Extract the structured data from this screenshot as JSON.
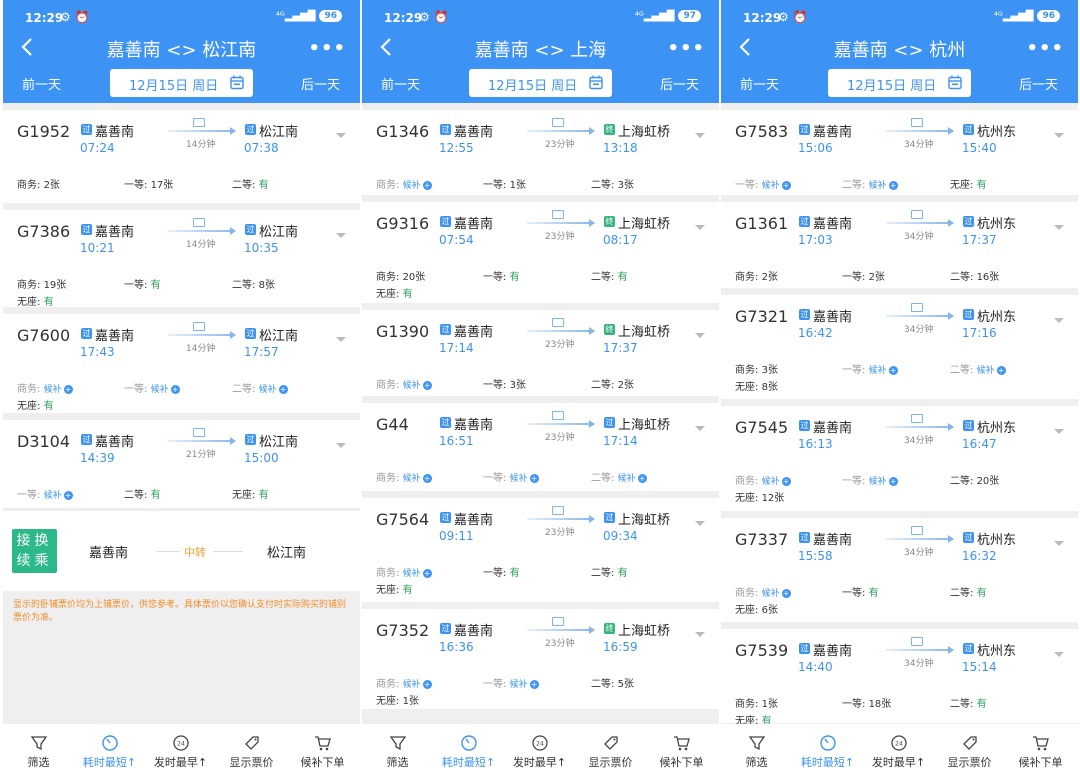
{
  "status": {
    "time": "12:29",
    "icons": "⚙ ⏰",
    "signal": "⁴ᴳ▂▄▆█"
  },
  "labels": {
    "prev_day": "前一天",
    "next_day": "后一天",
    "business": "商务:",
    "first": "一等:",
    "second": "二等:",
    "nostand": "无座:",
    "have": "有",
    "wait": "候补",
    "duration_badge": "过",
    "end_badge": "终"
  },
  "bottom_nav": [
    "筛选",
    "耗时最短↑",
    "发时最早↑",
    "显示票价",
    "候补下单"
  ],
  "panels": [
    {
      "title": "嘉善南 <> 松江南",
      "date": "12月15日 周日",
      "battery": "96",
      "trains": [
        {
          "no": "G1952",
          "from": "嘉善南",
          "to": "松江南",
          "dep": "07:24",
          "arr": "07:38",
          "dur": "14分钟",
          "end": false,
          "row1": [
            "商务: 2张",
            "一等: 17张",
            "二等: 有"
          ],
          "row2": []
        },
        {
          "no": "G7386",
          "from": "嘉善南",
          "to": "松江南",
          "dep": "10:21",
          "arr": "10:35",
          "dur": "14分钟",
          "end": false,
          "row1": [
            "商务: 19张",
            "一等: 有",
            "二等: 8张"
          ],
          "row2": [
            "无座: 有"
          ]
        },
        {
          "no": "G7600",
          "from": "嘉善南",
          "to": "松江南",
          "dep": "17:43",
          "arr": "17:57",
          "dur": "14分钟",
          "end": false,
          "row1": [
            "商务: 候补",
            "一等: 候补",
            "二等: 候补"
          ],
          "row2": [
            "无座: 有"
          ]
        },
        {
          "no": "D3104",
          "from": "嘉善南",
          "to": "松江南",
          "dep": "14:39",
          "arr": "15:00",
          "dur": "21分钟",
          "end": false,
          "row1": [
            "一等: 候补",
            "二等: 有",
            "无座: 有"
          ],
          "row2": []
        }
      ],
      "transfer": {
        "badge": "接换续乘",
        "from": "嘉善南",
        "mid": "中转",
        "to": "松江南"
      },
      "notice": "显示的卧铺票价均为上铺票价，供您参考。具体票价以您确认支付时实际购买的铺别票价为准。"
    },
    {
      "title": "嘉善南 <> 上海",
      "date": "12月15日 周日",
      "battery": "97",
      "trains": [
        {
          "no": "G1346",
          "from": "嘉善南",
          "to": "上海虹桥",
          "dep": "12:55",
          "arr": "13:18",
          "dur": "23分钟",
          "end": true,
          "row1": [
            "商务: 候补",
            "一等: 1张",
            "二等: 3张"
          ],
          "row2": []
        },
        {
          "no": "G9316",
          "from": "嘉善南",
          "to": "上海虹桥",
          "dep": "07:54",
          "arr": "08:17",
          "dur": "23分钟",
          "end": true,
          "row1": [
            "商务: 20张",
            "一等: 有",
            "二等: 有"
          ],
          "row2": [
            "无座: 有"
          ]
        },
        {
          "no": "G1390",
          "from": "嘉善南",
          "to": "上海虹桥",
          "dep": "17:14",
          "arr": "17:37",
          "dur": "23分钟",
          "end": true,
          "row1": [
            "商务: 候补",
            "一等: 3张",
            "二等: 2张"
          ],
          "row2": []
        },
        {
          "no": "G44",
          "from": "嘉善南",
          "to": "上海虹桥",
          "dep": "16:51",
          "arr": "17:14",
          "dur": "23分钟",
          "end": false,
          "row1": [
            "商务: 候补",
            "一等: 候补",
            "二等: 候补"
          ],
          "row2": []
        },
        {
          "no": "G7564",
          "from": "嘉善南",
          "to": "上海虹桥",
          "dep": "09:11",
          "arr": "09:34",
          "dur": "23分钟",
          "end": false,
          "row1": [
            "商务: 候补",
            "一等: 有",
            "二等: 有"
          ],
          "row2": [
            "无座: 有"
          ]
        },
        {
          "no": "G7352",
          "from": "嘉善南",
          "to": "上海虹桥",
          "dep": "16:36",
          "arr": "16:59",
          "dur": "23分钟",
          "end": true,
          "row1": [
            "商务: 候补",
            "一等: 候补",
            "二等: 5张"
          ],
          "row2": [
            "无座: 1张"
          ]
        }
      ]
    },
    {
      "title": "嘉善南 <> 杭州",
      "date": "12月15日 周日",
      "battery": "96",
      "trains": [
        {
          "no": "G7583",
          "from": "嘉善南",
          "to": "杭州东",
          "dep": "15:06",
          "arr": "15:40",
          "dur": "34分钟",
          "end": false,
          "row1": [
            "一等: 候补",
            "二等: 候补",
            "无座: 有"
          ],
          "row2": []
        },
        {
          "no": "G1361",
          "from": "嘉善南",
          "to": "杭州东",
          "dep": "17:03",
          "arr": "17:37",
          "dur": "34分钟",
          "end": false,
          "row1": [
            "商务: 2张",
            "一等: 2张",
            "二等: 16张"
          ],
          "row2": []
        },
        {
          "no": "G7321",
          "from": "嘉善南",
          "to": "杭州东",
          "dep": "16:42",
          "arr": "17:16",
          "dur": "34分钟",
          "end": false,
          "row1": [
            "商务: 3张",
            "一等: 候补",
            "二等: 候补"
          ],
          "row2": [
            "无座: 8张"
          ]
        },
        {
          "no": "G7545",
          "from": "嘉善南",
          "to": "杭州东",
          "dep": "16:13",
          "arr": "16:47",
          "dur": "34分钟",
          "end": false,
          "row1": [
            "商务: 候补",
            "一等: 候补",
            "二等: 20张"
          ],
          "row2": [
            "无座: 12张"
          ]
        },
        {
          "no": "G7337",
          "from": "嘉善南",
          "to": "杭州东",
          "dep": "15:58",
          "arr": "16:32",
          "dur": "34分钟",
          "end": false,
          "row1": [
            "商务: 候补",
            "一等: 有",
            "二等: 有"
          ],
          "row2": [
            "无座: 6张"
          ]
        },
        {
          "no": "G7539",
          "from": "嘉善南",
          "to": "杭州东",
          "dep": "14:40",
          "arr": "15:14",
          "dur": "34分钟",
          "end": false,
          "row1": [
            "商务: 1张",
            "一等: 18张",
            "二等: 有"
          ],
          "row2": [
            "无座: 有"
          ]
        }
      ]
    }
  ]
}
